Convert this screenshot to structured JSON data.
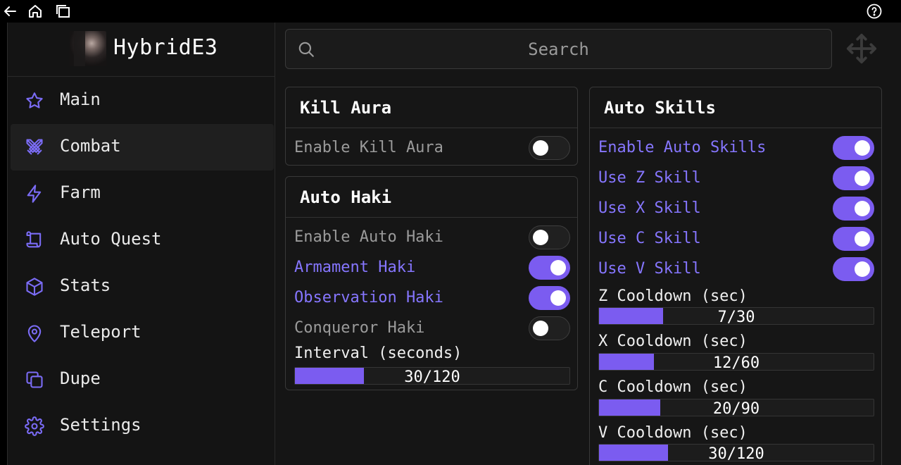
{
  "profile": {
    "username": "HybridE3"
  },
  "nav": [
    {
      "label": "Main",
      "icon": "star-icon"
    },
    {
      "label": "Combat",
      "icon": "swords-icon",
      "active": true
    },
    {
      "label": "Farm",
      "icon": "lightning-icon"
    },
    {
      "label": "Auto Quest",
      "icon": "scroll-icon"
    },
    {
      "label": "Stats",
      "icon": "cube-icon"
    },
    {
      "label": "Teleport",
      "icon": "map-pin-icon"
    },
    {
      "label": "Dupe",
      "icon": "copy-icon"
    },
    {
      "label": "Settings",
      "icon": "gear-icon"
    }
  ],
  "search": {
    "placeholder": "Search"
  },
  "kill_aura": {
    "title": "Kill Aura",
    "toggles": [
      {
        "label": "Enable Kill Aura",
        "on": false
      }
    ]
  },
  "auto_haki": {
    "title": "Auto Haki",
    "toggles": [
      {
        "label": "Enable Auto Haki",
        "on": false
      },
      {
        "label": "Armament Haki",
        "on": true
      },
      {
        "label": "Observation Haki",
        "on": true
      },
      {
        "label": "Conqueror Haki",
        "on": false
      }
    ],
    "interval": {
      "label": "Interval (seconds)",
      "text": "30/120",
      "value": 30,
      "max": 120
    }
  },
  "auto_skills": {
    "title": "Auto Skills",
    "toggles": [
      {
        "label": "Enable Auto Skills",
        "on": true
      },
      {
        "label": "Use Z Skill",
        "on": true
      },
      {
        "label": "Use X Skill",
        "on": true
      },
      {
        "label": "Use C Skill",
        "on": true
      },
      {
        "label": "Use V Skill",
        "on": true
      }
    ],
    "cooldowns": [
      {
        "label": "Z Cooldown (sec)",
        "text": "7/30",
        "value": 7,
        "max": 30
      },
      {
        "label": "X Cooldown (sec)",
        "text": "12/60",
        "value": 12,
        "max": 60
      },
      {
        "label": "C Cooldown (sec)",
        "text": "20/90",
        "value": 20,
        "max": 90
      },
      {
        "label": "V Cooldown (sec)",
        "text": "30/120",
        "value": 30,
        "max": 120
      }
    ]
  },
  "colors": {
    "accent": "#7b5cf0",
    "accent_text": "#8676ff",
    "background": "#151515"
  }
}
